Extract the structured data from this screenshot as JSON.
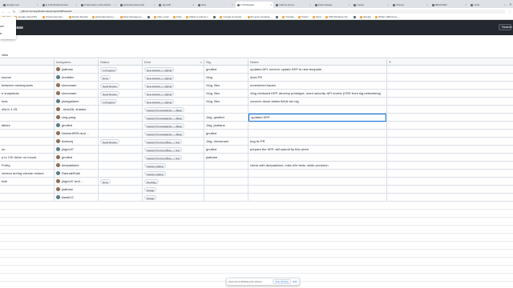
{
  "browser": {
    "tabs": [
      {
        "label": "Google.com"
      },
      {
        "label": "Q 2.26 Enhancement"
      },
      {
        "label": "Kubernetes 1.26 enhancements"
      },
      {
        "label": "pull-kubernetes-e2e"
      },
      {
        "label": "sig-auth"
      },
      {
        "label": "docs"
      },
      {
        "label": "1.26 Release",
        "active": true
      },
      {
        "label": "Volume Group"
      },
      {
        "label": "kube-storage"
      },
      {
        "label": "Issues"
      },
      {
        "label": "Volume"
      },
      {
        "label": "RECOVER"
      },
      {
        "label": "Code"
      }
    ],
    "url": "github.com/orgs/kubernetes/projects/98/views/1",
    "bookmarks": [
      "Jobs",
      "Google Cloud Pla...",
      "Kubernetes Ent...",
      "Search Results",
      "pull-kubernetes-e...",
      "https://storage.go...",
      "",
      "kube_tools",
      "Kube",
      "Attach a volume t...",
      "",
      "Google Compute...",
      "Fix auto-complete...",
      "",
      "Youtube",
      "Teams",
      "Inbox",
      "K8S Windows No...",
      "",
      "Vendep",
      "What's difference..."
    ]
  },
  "app": {
    "title": "Release",
    "header_button": "Search"
  },
  "popup": {
    "items": [
      "ort",
      "e"
    ]
  },
  "view": {
    "tab_label": "view"
  },
  "table": {
    "add_column": "+",
    "columns": {
      "title": "",
      "assignees": "Assignees",
      "status": "Status",
      "kind": "Kind",
      "sig": "Sig",
      "notes": "Notes"
    },
    "rows": [
      {
        "title": "",
        "assignee": "jsafrane",
        "status": "In Progress",
        "kind": "New Feature (-->Alpha)",
        "sig": "gnufied",
        "notes": "updated API, need to update KEP to new template"
      },
      {
        "title": "source",
        "assignee": "humblec",
        "status": "Done",
        "kind": "New Feature (-->Alpha)",
        "sig": "Xing",
        "notes": "docs PR"
      },
      {
        "title": "between namespaces",
        "assignee": "nkvnunam",
        "status": "Need Review",
        "kind": "New Feature (-->Alpha)",
        "sig": "Xing, Ben",
        "notes": "unresolved issues"
      },
      {
        "title": "e snapshots",
        "assignee": "nkvnunam",
        "status": "Need Review",
        "kind": "New Feature (-->Alpha)",
        "sig": "Xing, Ben",
        "notes": "Xing reviewed KEP, develop prototype, need security, API review (CRD from sig-networking)"
      },
      {
        "title": "mes",
        "assignee": "pluisgalarmi",
        "status": "In Progress",
        "kind": "New Feature (-->Alpha)",
        "sig": "Xing, Ben",
        "notes": "concern about status fields too big"
      },
      {
        "title": "olla in 1.25",
        "assignee": "..itesh26, shadmi...",
        "status": "",
        "kind": "Feature Promote(Alpha --> Beta)",
        "sig": "",
        "notes": ""
      },
      {
        "title": "",
        "assignee": "xing-yang",
        "status": "",
        "kind": "Feature Promote(Alpha --> Beta)",
        "sig": "Jing, gnufied",
        "notes": "updated KEP"
      },
      {
        "title": "failure",
        "assignee": "gnufied",
        "status": "",
        "kind": "Feature Promote(Alpha --> Beta)",
        "sig": "Jing, jsafrane",
        "notes": ""
      },
      {
        "title": "",
        "assignee": "NickrenREN and ...",
        "status": "",
        "kind": "Feature Promote(Alpha --> Beta)",
        "sig": "gnufied",
        "notes": ""
      },
      {
        "title": "",
        "assignee": "dobsonj",
        "status": "Need Review",
        "kind": "Feature Promote (Beta --> GA)",
        "sig": "Jing, nkvnunam",
        "notes": "bug fix PR"
      },
      {
        "title": "on",
        "assignee": "jingxu97",
        "status": "",
        "kind": "Feature Promote (Beta --> GA)",
        "sig": "gnufied",
        "notes": "prepare the KEP, will submit by this week"
      },
      {
        "title": "p to CSI driver on mount",
        "assignee": "gnufied",
        "status": "",
        "kind": "Feature Promote (Beta --> GA)",
        "sig": "jsafrane",
        "notes": ""
      },
      {
        "title": "Policy",
        "assignee": "deepakkinni",
        "status": "",
        "kind": "Feature (Alpha)",
        "sig": "",
        "notes": "check with deepakkinni, miss e2e tests, static provision"
      },
      {
        "title": "version during volume restore",
        "assignee": "RaunakShah",
        "status": "",
        "kind": "Feature (Alpha)",
        "sig": "",
        "notes": ""
      },
      {
        "title": "ticle",
        "assignee": "jingxu97 and ...",
        "status": "Done",
        "kind": "Doc/blog",
        "sig": "",
        "notes": ""
      },
      {
        "title": "",
        "assignee": "jsafrane",
        "status": "",
        "kind": "Design",
        "sig": "",
        "notes": ""
      },
      {
        "title": "",
        "assignee": "kiawb12",
        "status": "",
        "kind": "Design",
        "sig": "",
        "notes": ""
      }
    ]
  },
  "sharing": {
    "message": "zoom.us is sharing your screen.",
    "stop_label": "Stop sharing",
    "hide_label": "Hide"
  }
}
